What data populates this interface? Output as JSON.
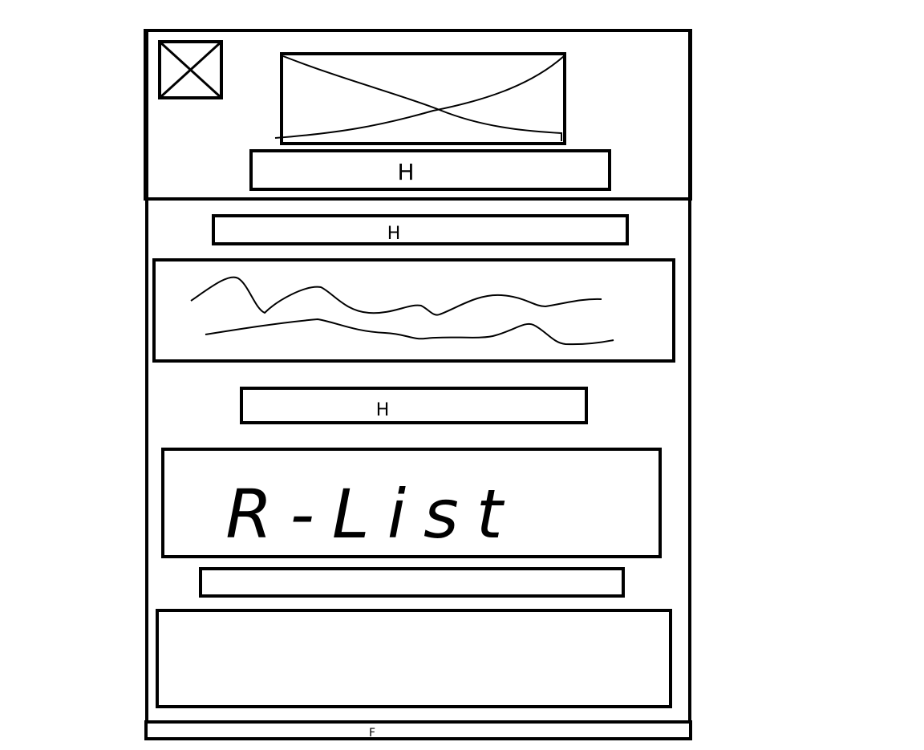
{
  "colors": {
    "background": "#ffffff",
    "stroke": "#000000"
  },
  "header": {
    "logo_placeholder": "image-placeholder-icon",
    "banner_placeholder": "image-placeholder-icon",
    "heading_label": "H"
  },
  "main": {
    "section_heading_1_label": "H",
    "text_block": "scribble-text-placeholder",
    "section_heading_2_label": "H",
    "list_box_label": "R-List"
  },
  "footer": {
    "label": "F"
  }
}
